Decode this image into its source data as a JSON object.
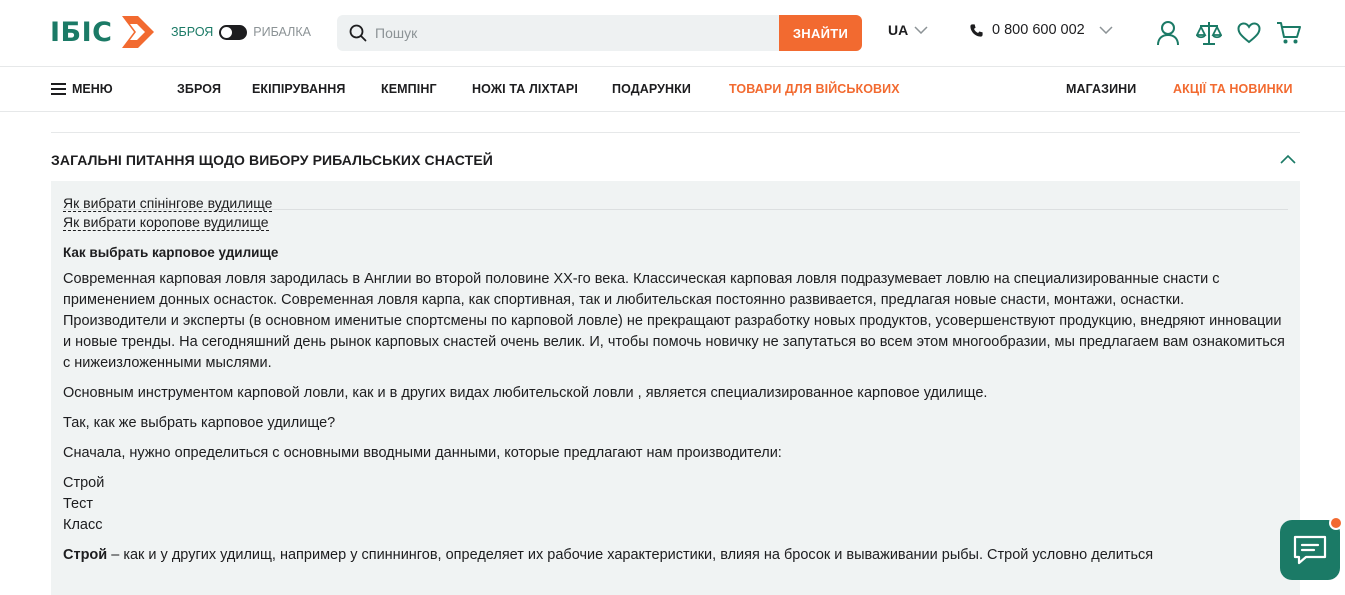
{
  "header": {
    "logo_text": "ІБІС",
    "switch": {
      "left_label": "ЗБРОЯ",
      "right_label": "РИБАЛКА"
    },
    "search": {
      "placeholder": "Пошук",
      "button_label": "ЗНАЙТИ"
    },
    "language": "UA",
    "phone": "0 800 600 002"
  },
  "nav": {
    "menu_label": "МЕНЮ",
    "items": [
      {
        "label": "ЗБРОЯ"
      },
      {
        "label": "ЕКІПІРУВАННЯ"
      },
      {
        "label": "КЕМПІНГ"
      },
      {
        "label": "НОЖІ ТА ЛІХТАРІ"
      },
      {
        "label": "ПОДАРУНКИ"
      },
      {
        "label": "ТОВАРИ ДЛЯ ВІЙСЬКОВИХ"
      }
    ],
    "right_items": [
      {
        "label": "МАГАЗИНИ"
      },
      {
        "label": "АКЦІЇ ТА НОВИНКИ"
      }
    ]
  },
  "accordion": {
    "title": "ЗАГАЛЬНІ ПИТАННЯ ЩОДО ВИБОРУ РИБАЛЬСЬКИХ СНАСТЕЙ",
    "links": [
      {
        "label": "Як вибрати спінінгове вудилище"
      },
      {
        "label": "Як вибрати коропове вудилище"
      }
    ],
    "article": {
      "heading": "Как выбрать карповое удилище",
      "paragraphs": [
        "Современная карповая ловля зародилась в Англии во второй половине ХХ-го века. Классическая карповая ловля подразумевает ловлю на специализированные снасти с применением донных оснасток. Современная ловля карпа, как спортивная, так и любительская постоянно развивается, предлагая новые снасти, монтажи, оснастки. Производители  и эксперты (в основном именитые спортсмены по  карповой ловле) не прекращают разработку новых продуктов, усовершенствуют продукцию, внедряют инновации и новые тренды. На сегодняшний день рынок карповых снастей очень велик. И, чтобы помочь новичку не запутаться во всем этом многообразии, мы предлагаем вам ознакомиться с нижеизложенными мыслями.",
        "Основным инструментом карповой ловли, как и в других видах любительской ловли , является специализированное карповое удилище.",
        "Так, как же выбрать карповое удилище?",
        "Сначала, нужно определиться с основными вводными данными, которые предлагают нам производители:"
      ],
      "list": [
        "Строй",
        "Тест",
        "Класс"
      ],
      "last_paragraph_bold": "Строй",
      "last_paragraph_rest": " – как и у других удилищ, например у спиннингов, определяет их рабочие характеристики, влияя на бросок и вываживании рыбы. Строй условно делиться"
    }
  },
  "colors": {
    "brand_green": "#1b7a66",
    "accent_orange": "#f26a30",
    "panel_bg": "#f0f3f3"
  }
}
